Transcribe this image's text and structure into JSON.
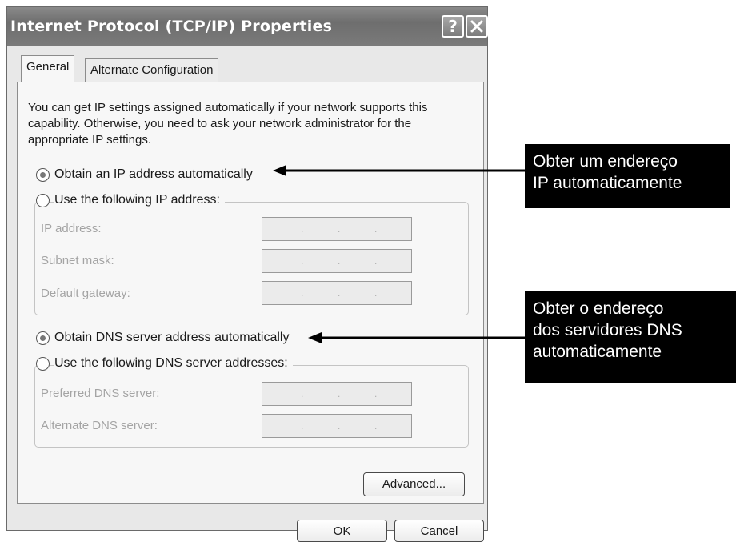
{
  "dialog": {
    "title": "Internet Protocol (TCP/IP) Properties",
    "help_label": "?",
    "tabs": [
      {
        "label": "General",
        "active": true
      },
      {
        "label": "Alternate Configuration",
        "active": false
      }
    ],
    "description": "You can get IP settings assigned automatically if your network supports this capability. Otherwise, you need to ask your network administrator for the appropriate IP settings.",
    "ip": {
      "auto_label": "Obtain an IP address automatically",
      "auto_selected": true,
      "manual_label": "Use the following IP address:",
      "fields": [
        {
          "label": "IP address:",
          "value": ". . ."
        },
        {
          "label": "Subnet mask:",
          "value": ". . ."
        },
        {
          "label": "Default gateway:",
          "value": ". . ."
        }
      ]
    },
    "dns": {
      "auto_label": "Obtain DNS server address automatically",
      "auto_selected": true,
      "manual_label": "Use the following DNS server addresses:",
      "fields": [
        {
          "label": "Preferred DNS server:",
          "value": ". . ."
        },
        {
          "label": "Alternate DNS server:",
          "value": ". . ."
        }
      ]
    },
    "advanced_label": "Advanced...",
    "ok_label": "OK",
    "cancel_label": "Cancel"
  },
  "annotations": [
    {
      "lines": [
        "Obter um endereço",
        "IP automaticamente"
      ]
    },
    {
      "lines": [
        "Obter o endereço",
        "dos servidores DNS",
        "automaticamente"
      ]
    }
  ],
  "colors": {
    "titlebar": "#7a7a7a",
    "dialog_bg": "#e8e8e8",
    "callout_bg": "#000000"
  }
}
